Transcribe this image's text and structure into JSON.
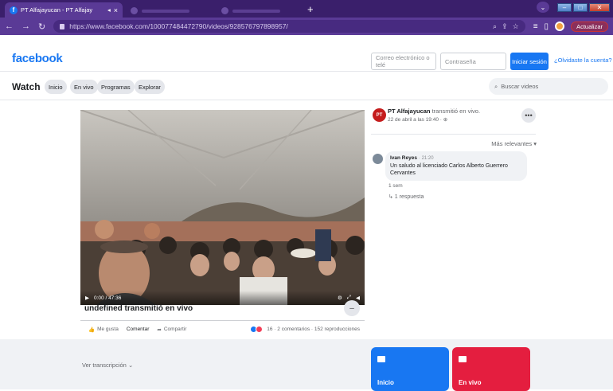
{
  "browser": {
    "tab_title": "PT Alfajayucan - PT Alfajay",
    "url": "https://www.facebook.com/100077484472790/videos/928576797898957/",
    "update_label": "Actualizar"
  },
  "fb": {
    "logo": "facebook",
    "email_placeholder": "Correo electrónico o telé",
    "password_placeholder": "Contraseña",
    "login_label": "Iniciar sesión",
    "forgot_label": "¿Olvidaste la cuenta?"
  },
  "watch": {
    "title": "Watch",
    "tabs": [
      "Inicio",
      "En vivo",
      "Programas",
      "Explorar"
    ],
    "search_placeholder": "Buscar videos"
  },
  "video": {
    "time": "0:00 / 47:36",
    "title": "undefined transmitió en vivo",
    "actions": {
      "like": "Me gusta",
      "comment": "Comentar",
      "share": "Compartir"
    },
    "stats": "16 · 2 comentarios · 152 reproducciones"
  },
  "post": {
    "page_name": "PT Alfajayucan",
    "action_text": "transmitió en vivo.",
    "date": "22 de abril a las 19:40 · ",
    "sort_label": "Más relevantes ▾"
  },
  "comment": {
    "author": "Ivan Reyes",
    "time": "· 21:20",
    "text": "Un saludo al licenciado Carlos Alberto Guerrero Cervantes",
    "age": "1 sem",
    "reply_label": "↳ 1 respuesta"
  },
  "bottom": {
    "transcript_label": "Ver transcripción ⌄",
    "card_home": "Inicio",
    "card_live": "En vivo"
  },
  "colors": {
    "fb_blue": "#1877f2",
    "live_red": "#e41e3f",
    "chrome_purple": "#5a3a96"
  }
}
